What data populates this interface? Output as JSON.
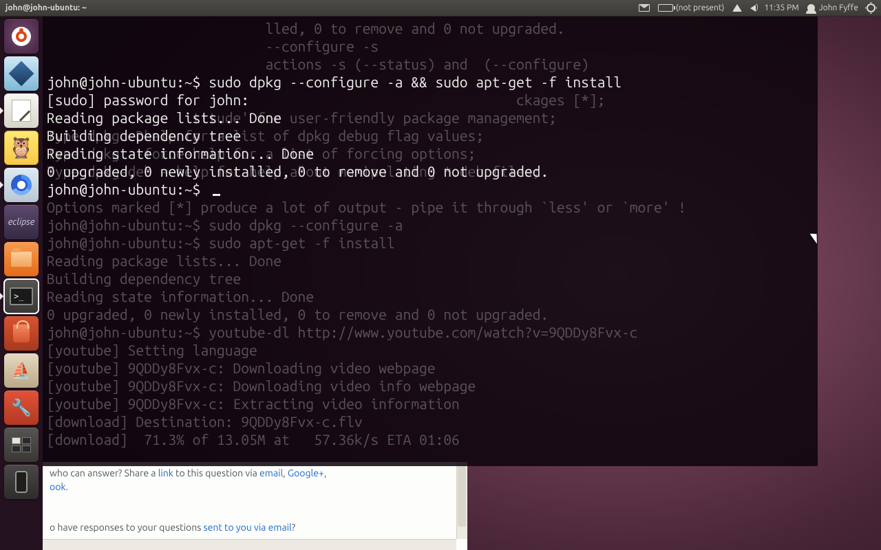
{
  "panel": {
    "window_title": "john@john-ubuntu: ~",
    "battery_text": "(not present)",
    "clock": "11:35 PM",
    "user": "John Fyffe"
  },
  "launcher": {
    "items": [
      {
        "name": "dash-home",
        "tip": "Dash Home"
      },
      {
        "name": "virtualbox",
        "tip": "VirtualBox"
      },
      {
        "name": "gedit",
        "tip": "Text Editor"
      },
      {
        "name": "idle-python",
        "tip": "IDLE Python"
      },
      {
        "name": "chromium",
        "tip": "Chromium"
      },
      {
        "name": "eclipse",
        "tip": "Eclipse",
        "label": "eclipse"
      },
      {
        "name": "nautilus",
        "tip": "Files"
      },
      {
        "name": "gnome-terminal",
        "tip": "Terminal"
      },
      {
        "name": "software-center",
        "tip": "Ubuntu Software Center"
      },
      {
        "name": "vessel",
        "tip": "Vessel"
      },
      {
        "name": "system-settings",
        "tip": "System Settings"
      },
      {
        "name": "workspace-switcher",
        "tip": "Workspace Switcher"
      },
      {
        "name": "phone",
        "tip": "Phone"
      }
    ]
  },
  "terminal": {
    "fg_lines": [
      "john@john-ubuntu:~$ sudo dpkg --configure -a && sudo apt-get -f install",
      "[sudo] password for john: ",
      "Reading package lists... Done",
      "Building dependency tree       ",
      "Reading state information... Done",
      "0 upgraded, 0 newly installed, 0 to remove and 0 not upgraded.",
      "john@john-ubuntu:~$ "
    ],
    "bg_lines": [
      "                           lled, 0 to remove and 0 not upgraded.",
      "                           --configure -s",
      "                           actions -s (--status) and  (--configure)",
      "",
      "                                                          ckages [*];",
      "                  titude' for user-friendly package management;",
      "Type dpkg -Dhelp for a list of dpkg debug flag values;",
      "Type dpkg --force-help for a list of forcing options;",
      "Type dpkg-deb --help for help about manipulating *.deb files;",
      "",
      "Options marked [*] produce a lot of output - pipe it through `less' or `more' !",
      "john@john-ubuntu:~$ sudo dpkg --configure -a",
      "john@john-ubuntu:~$ sudo apt-get -f install",
      "Reading package lists... Done",
      "Building dependency tree       ",
      "Reading state information... Done",
      "0 upgraded, 0 newly installed, 0 to remove and 0 not upgraded.",
      "john@john-ubuntu:~$ youtube-dl http://www.youtube.com/watch?v=9QDDy8Fvx-c",
      "[youtube] Setting language",
      "[youtube] 9QDDy8Fvx-c: Downloading video webpage",
      "[youtube] 9QDDy8Fvx-c: Downloading video info webpage",
      "[youtube] 9QDDy8Fvx-c: Extracting video information",
      "[download] Destination: 9QDDy8Fvx-c.flv",
      "[download]  71.3% of 13.05M at   57.36k/s ETA 01:06"
    ]
  },
  "bg_page": {
    "line1_pre": "who can answer? Share a ",
    "line1_link": "link",
    "line1_mid": " to this question via ",
    "line1_email": "email",
    "line1_gplus": "Google+",
    "line1_facebook": "ook",
    "line1_end": ".",
    "line2_pre": "o have responses to your questions ",
    "line2_link": "sent to you via email",
    "line2_end": "?"
  }
}
